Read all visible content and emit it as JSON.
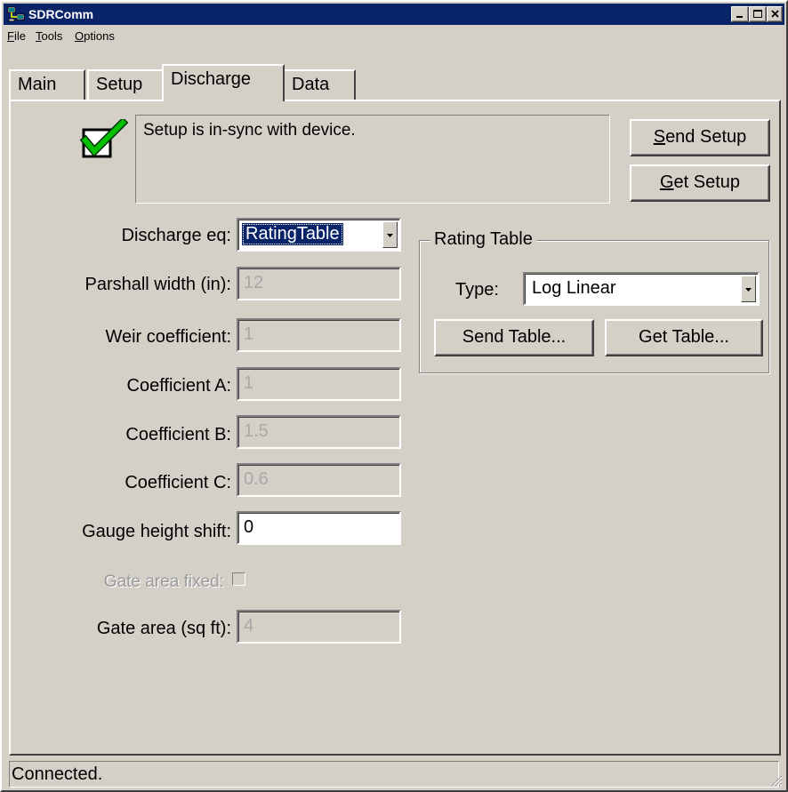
{
  "window": {
    "title": "SDRComm"
  },
  "menu": {
    "file": "File",
    "tools": "Tools",
    "options": "Options"
  },
  "tabs": [
    {
      "label": "Main"
    },
    {
      "label": "Setup"
    },
    {
      "label": "Discharge"
    },
    {
      "label": "Data"
    }
  ],
  "active_tab": "Discharge",
  "sync": {
    "icon": "check-icon",
    "message": "Setup is in-sync with device.",
    "send_label": "Send Setup",
    "get_label": "Get Setup"
  },
  "form": {
    "discharge_eq": {
      "label": "Discharge eq:",
      "value": "RatingTable"
    },
    "parshall_width": {
      "label": "Parshall width (in):",
      "value": "12"
    },
    "weir_coefficient": {
      "label": "Weir coefficient:",
      "value": "1"
    },
    "coefficient_a": {
      "label": "Coefficient A:",
      "value": "1"
    },
    "coefficient_b": {
      "label": "Coefficient B:",
      "value": "1.5"
    },
    "coefficient_c": {
      "label": "Coefficient C:",
      "value": "0.6"
    },
    "gauge_height_shift": {
      "label": "Gauge height shift:",
      "value": "0"
    },
    "gate_area_fixed": {
      "label": "Gate area fixed:",
      "checked": false
    },
    "gate_area": {
      "label": "Gate area (sq ft):",
      "value": "4"
    }
  },
  "rating_table": {
    "title": "Rating Table",
    "type_label": "Type:",
    "type_value": "Log Linear",
    "send_label": "Send Table...",
    "get_label": "Get Table..."
  },
  "status": {
    "text": "Connected."
  },
  "colors": {
    "titlebar": "#0a246a",
    "face": "#d4d0c8",
    "check": "#00c000"
  }
}
